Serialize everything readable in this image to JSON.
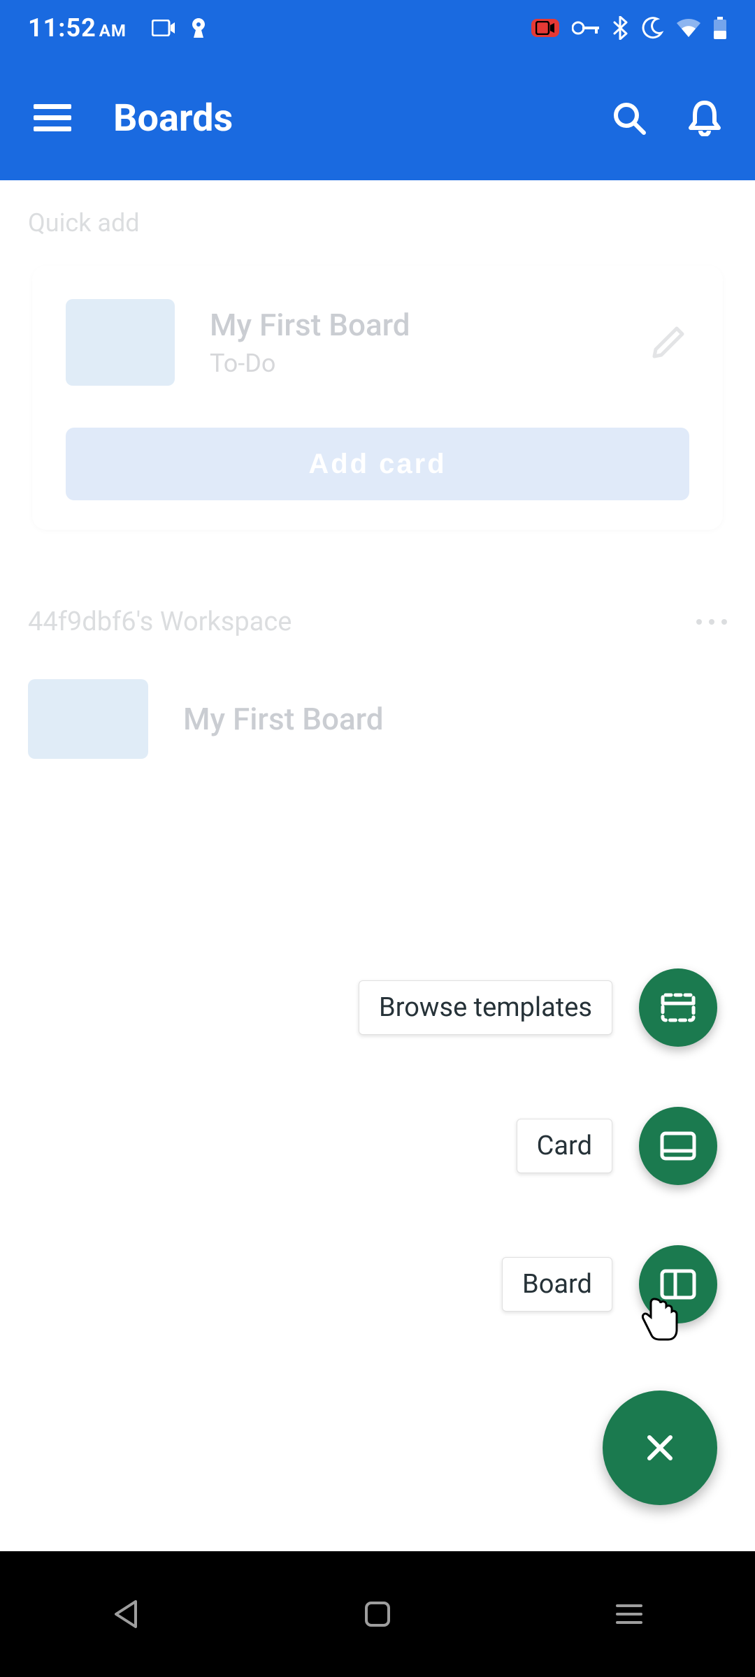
{
  "status_bar": {
    "time": "11:52",
    "ampm": "AM",
    "left_icons": [
      "video-icon",
      "hotspot-icon"
    ],
    "right_icons": [
      "record-icon",
      "vpn-key-icon",
      "bluetooth-icon",
      "dnd-moon-icon",
      "wifi-icon",
      "battery-icon"
    ]
  },
  "app_bar": {
    "title": "Boards"
  },
  "quick_add": {
    "label": "Quick add",
    "board_title": "My First Board",
    "board_subtitle": "To-Do",
    "add_button": "Add card"
  },
  "workspace": {
    "name": "44f9dbf6's Workspace",
    "boards": [
      {
        "title": "My First Board"
      }
    ]
  },
  "fab": {
    "items": [
      {
        "label": "Browse templates",
        "icon": "template-icon"
      },
      {
        "label": "Card",
        "icon": "card-icon"
      },
      {
        "label": "Board",
        "icon": "board-icon"
      }
    ],
    "close": "close-icon"
  },
  "colors": {
    "primary": "#1a6ae0",
    "fab": "#1b7a4f",
    "board_thumb": "#a9cbea"
  }
}
